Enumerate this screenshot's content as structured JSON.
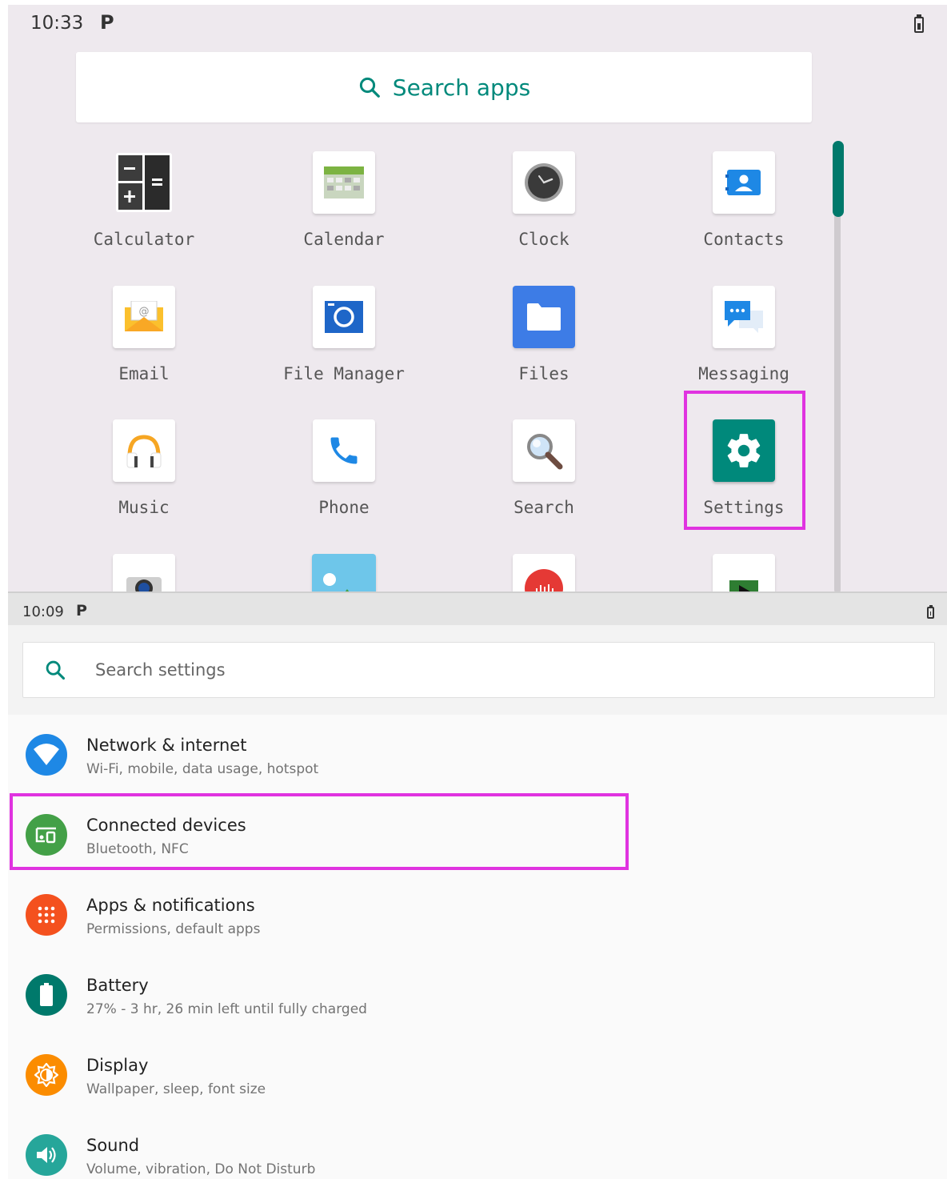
{
  "drawer": {
    "status": {
      "time": "10:33",
      "notif": "P"
    },
    "search_label": "Search apps",
    "apps": [
      {
        "label": "Calculator",
        "icon": "calculator-icon"
      },
      {
        "label": "Calendar",
        "icon": "calendar-icon"
      },
      {
        "label": "Clock",
        "icon": "clock-icon"
      },
      {
        "label": "Contacts",
        "icon": "contacts-icon"
      },
      {
        "label": "Email",
        "icon": "email-icon"
      },
      {
        "label": "File Manager",
        "icon": "file-manager-icon"
      },
      {
        "label": "Files",
        "icon": "files-icon"
      },
      {
        "label": "Messaging",
        "icon": "messaging-icon"
      },
      {
        "label": "Music",
        "icon": "music-icon"
      },
      {
        "label": "Phone",
        "icon": "phone-icon"
      },
      {
        "label": "Search",
        "icon": "search-icon"
      },
      {
        "label": "Settings",
        "icon": "settings-gear-icon"
      }
    ],
    "partial_row_icons": [
      "camera-icon",
      "gallery-icon",
      "sound-recorder-icon",
      "play-store-icon"
    ]
  },
  "settings": {
    "status": {
      "time": "10:09",
      "notif": "P"
    },
    "search_placeholder": "Search settings",
    "items": [
      {
        "title": "Network & internet",
        "subtitle": "Wi-Fi, mobile, data usage, hotspot",
        "color": "#1e88e5",
        "icon": "wifi-icon"
      },
      {
        "title": "Connected devices",
        "subtitle": "Bluetooth, NFC",
        "color": "#43a047",
        "icon": "devices-icon"
      },
      {
        "title": "Apps & notifications",
        "subtitle": "Permissions, default apps",
        "color": "#f4511e",
        "icon": "apps-icon"
      },
      {
        "title": "Battery",
        "subtitle": "27% - 3 hr, 26 min left until fully charged",
        "color": "#00796b",
        "icon": "battery-icon"
      },
      {
        "title": "Display",
        "subtitle": "Wallpaper, sleep, font size",
        "color": "#fb8c00",
        "icon": "brightness-icon"
      },
      {
        "title": "Sound",
        "subtitle": "Volume, vibration, Do Not Disturb",
        "color": "#26a69a",
        "icon": "volume-icon"
      }
    ]
  },
  "colors": {
    "accent": "#00897b",
    "highlight": "#e033e0"
  }
}
